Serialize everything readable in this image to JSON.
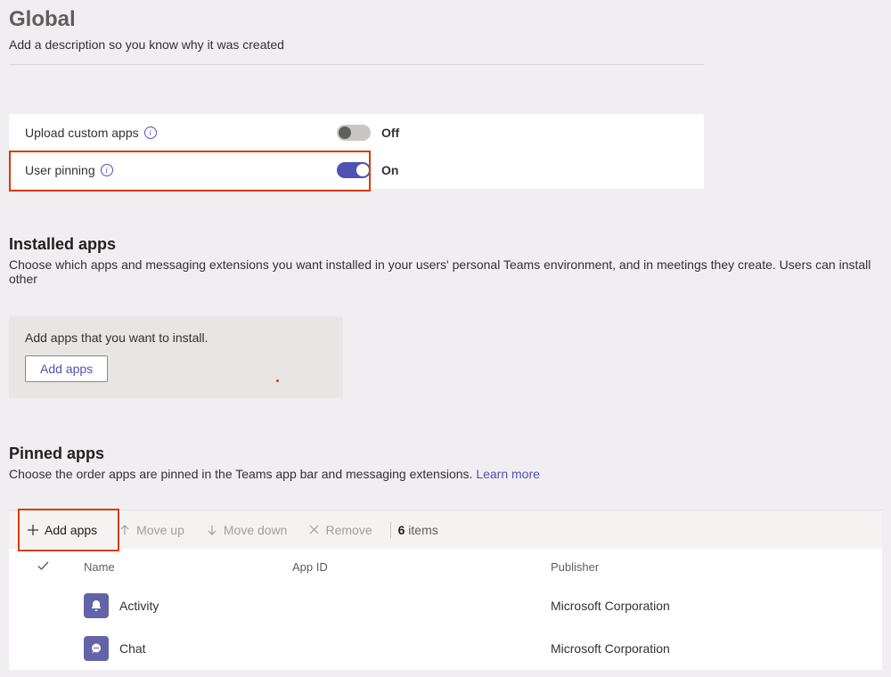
{
  "header": {
    "title": "Global",
    "description": "Add a description so you know why it was created"
  },
  "settings": {
    "upload_custom_apps": {
      "label": "Upload custom apps",
      "value_text": "Off",
      "on": false
    },
    "user_pinning": {
      "label": "User pinning",
      "value_text": "On",
      "on": true
    }
  },
  "installed": {
    "heading": "Installed apps",
    "description": "Choose which apps and messaging extensions you want installed in your users' personal Teams environment, and in meetings they create. Users can install other",
    "box_text": "Add apps that you want to install.",
    "add_button": "Add apps"
  },
  "pinned": {
    "heading": "Pinned apps",
    "description_prefix": "Choose the order apps are pinned in the Teams app bar and messaging extensions. ",
    "learn_more": "Learn more",
    "toolbar": {
      "add": "Add apps",
      "move_up": "Move up",
      "move_down": "Move down",
      "remove": "Remove",
      "count_num": "6",
      "count_label": " items"
    },
    "columns": {
      "name": "Name",
      "app_id": "App ID",
      "publisher": "Publisher"
    },
    "rows": [
      {
        "name": "Activity",
        "app_id": "",
        "publisher": "Microsoft Corporation",
        "icon": "bell"
      },
      {
        "name": "Chat",
        "app_id": "",
        "publisher": "Microsoft Corporation",
        "icon": "chat"
      }
    ]
  }
}
